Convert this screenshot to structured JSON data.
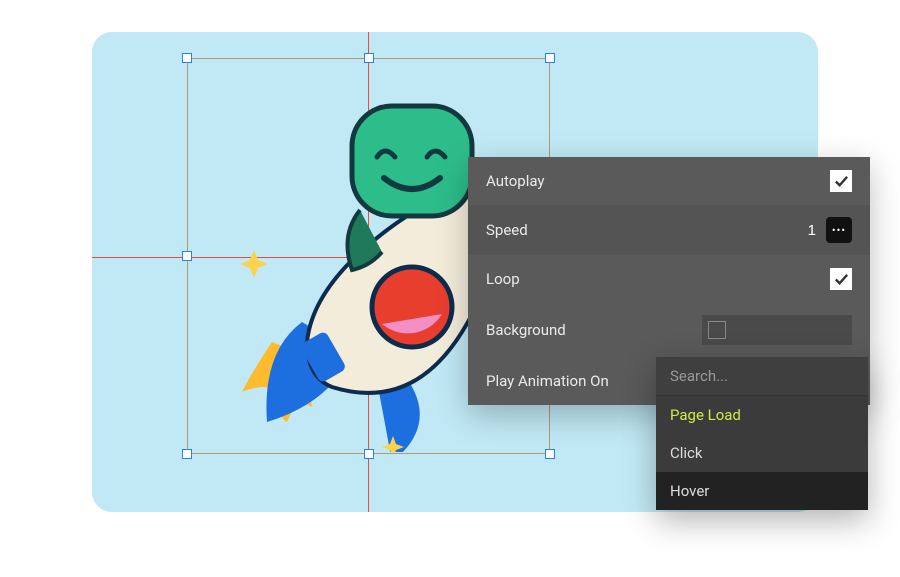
{
  "panel": {
    "autoplay": {
      "label": "Autoplay",
      "checked": true
    },
    "speed": {
      "label": "Speed",
      "value": "1"
    },
    "loop": {
      "label": "Loop",
      "checked": true
    },
    "background": {
      "label": "Background"
    },
    "play_on": {
      "label": "Play Animation On"
    }
  },
  "dropdown": {
    "search_placeholder": "Search...",
    "items": [
      {
        "label": "Page Load",
        "selected": true
      },
      {
        "label": "Click",
        "selected": false
      },
      {
        "label": "Hover",
        "selected": false,
        "hovered": true
      }
    ]
  }
}
